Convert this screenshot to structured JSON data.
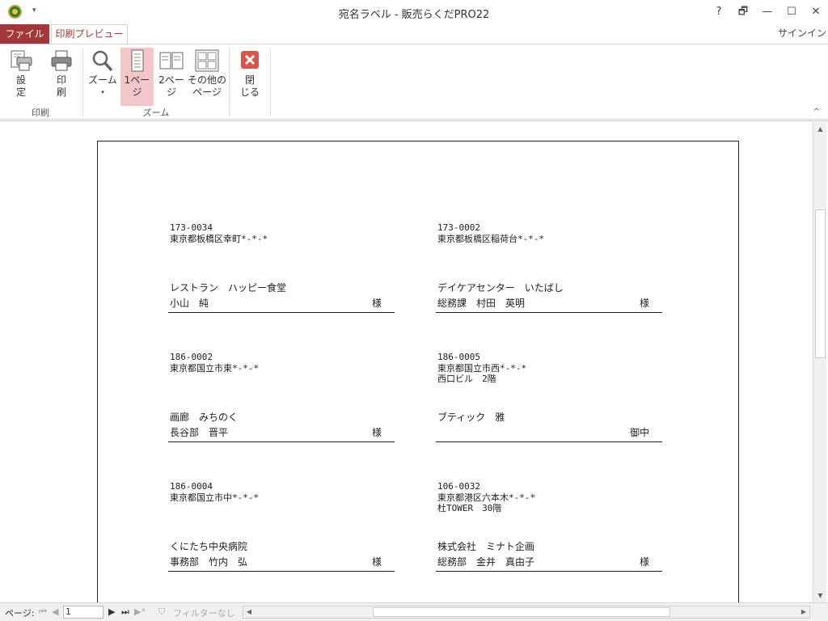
{
  "titlebar": {
    "qat_icon": "▾",
    "title": "宛名ラベル - 販売らくだPRO22",
    "help": "?",
    "restore": "🗗",
    "minimize": "—",
    "maximize": "☐",
    "close": "✕"
  },
  "tabs": {
    "file": "ファイル",
    "preview": "印刷プレビュー",
    "signin": "サインイン"
  },
  "ribbon": {
    "settings": "設\n定",
    "print": "印\n刷",
    "zoom": "ズーム",
    "one_page": "1ペー\nジ",
    "two_page": "2ペー\nジ",
    "other_pages": "その他の\nページ",
    "close": "閉\nじる",
    "group_print": "印刷",
    "group_zoom": "ズーム"
  },
  "labels": [
    {
      "zip": "173-0034",
      "address": "東京都板橋区幸町*-*-*",
      "name": "レストラン　ハッピー食堂",
      "person": "小山　純",
      "honorific": "様"
    },
    {
      "zip": "173-0002",
      "address": "東京都板橋区稲荷台*-*-*",
      "name": "デイケアセンター　いたばし",
      "person": "総務課　村田　英明",
      "honorific": "様"
    },
    {
      "zip": "186-0002",
      "address": "東京都国立市東*-*-*",
      "name": "画廊　みちのく",
      "person": "長谷部　晋平",
      "honorific": "様"
    },
    {
      "zip": "186-0005",
      "address": "東京都国立市西*-*-*\n西口ビル　2階",
      "name": "ブティック　雅",
      "person": "",
      "honorific": "御中"
    },
    {
      "zip": "186-0004",
      "address": "東京都国立市中*-*-*",
      "name": "くにたち中央病院",
      "person": "事務部　竹内　弘",
      "honorific": "様"
    },
    {
      "zip": "106-0032",
      "address": "東京都港区六本木*-*-*\n杜TOWER　30階",
      "name": "株式会社　ミナト企画",
      "person": "総務部　金井　真由子",
      "honorific": "様"
    }
  ],
  "statusbar": {
    "page_label": "ページ:",
    "first": "⏮",
    "prev": "◀",
    "page_value": "1",
    "next": "▶",
    "last": "⏭",
    "new": "▶*",
    "filter": "フィルターなし"
  },
  "colors": {
    "accent": "#a4373a",
    "active_button": "#f4c6c8"
  }
}
